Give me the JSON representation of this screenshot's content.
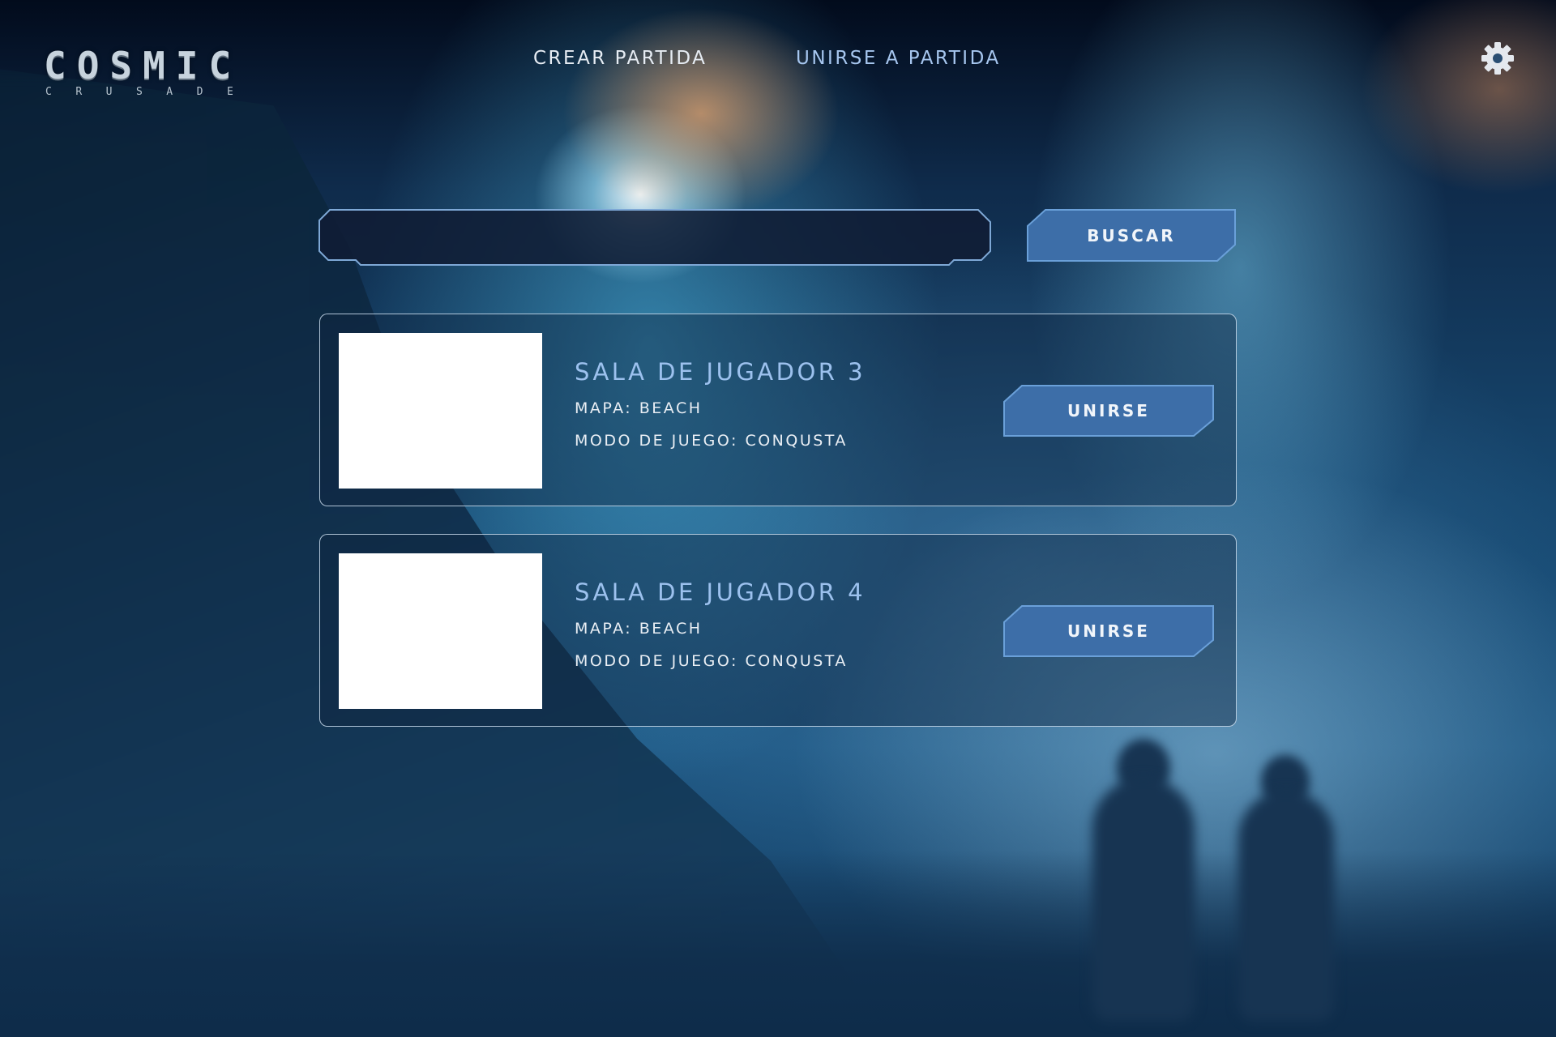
{
  "app": {
    "logo_main": "COSMIC",
    "logo_sub": "CRUSADE"
  },
  "header": {
    "nav": [
      {
        "label": "CREAR PARTIDA"
      },
      {
        "label": "UNIRSE A PARTIDA"
      }
    ],
    "settings_icon": "gear-icon"
  },
  "search": {
    "value": "",
    "placeholder": "",
    "button_label": "BUSCAR"
  },
  "rooms": [
    {
      "title": "SALA DE JUGADOR 3",
      "map": "MAPA: BEACH",
      "mode": "MODO DE JUEGO: CONQUSTA",
      "join_label": "UNIRSE"
    },
    {
      "title": "SALA DE JUGADOR 4",
      "map": "MAPA: BEACH",
      "mode": "MODO DE JUEGO: CONQUSTA",
      "join_label": "UNIRSE"
    }
  ],
  "colors": {
    "accent": "#9cc1ee",
    "button_fill": "#3d6ea8",
    "button_border": "#5f94cf",
    "text_primary": "#e9eef4"
  }
}
